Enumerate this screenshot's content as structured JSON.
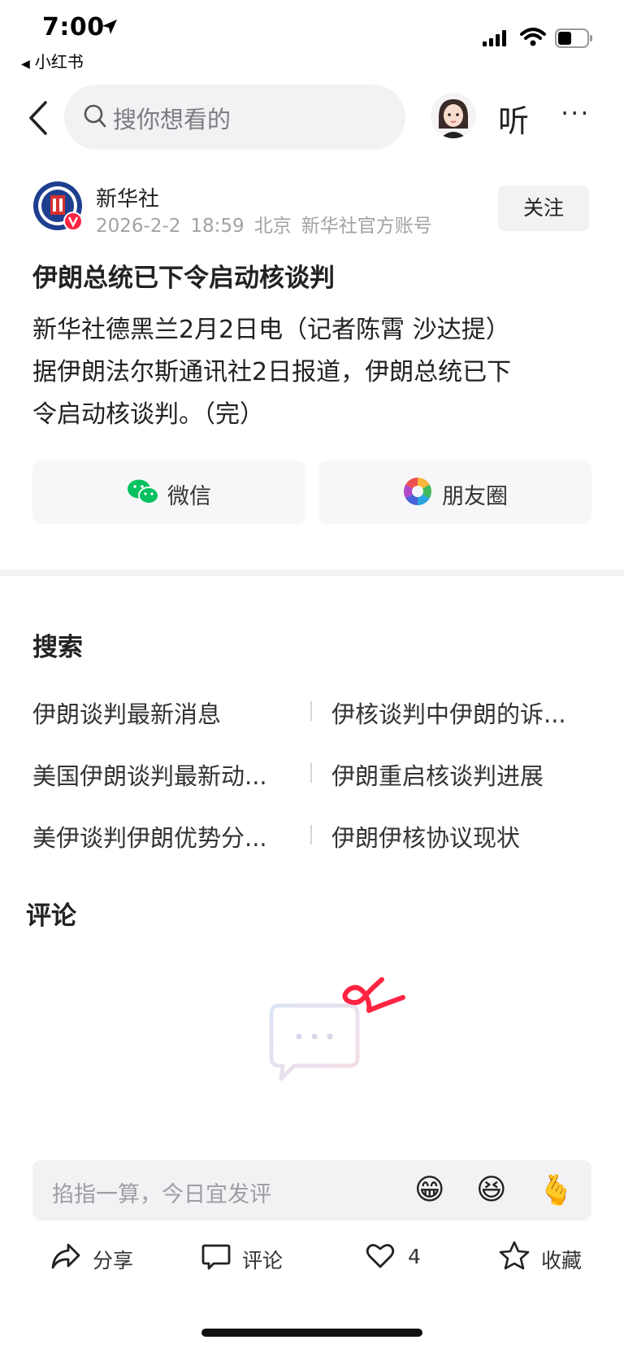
{
  "status_bar": {
    "time": "7:00",
    "back_app": "小红书"
  },
  "nav": {
    "search_placeholder": "搜你想看的",
    "listen_label": "听",
    "more_label": "···"
  },
  "author": {
    "name": "新华社",
    "date": "2026-2-2",
    "time": "18:59",
    "location": "北京",
    "account_type": "新华社官方账号",
    "follow_label": "关注"
  },
  "article": {
    "title": "伊朗总统已下令启动核谈判",
    "body_lines": [
      "新华社德黑兰2月2日电（记者陈霄 沙达提）",
      "据伊朗法尔斯通讯社2日报道，伊朗总统已下",
      "令启动核谈判。（完）"
    ]
  },
  "share": {
    "wechat_label": "微信",
    "moments_label": "朋友圈"
  },
  "search_section": {
    "heading": "搜索",
    "suggestions": [
      [
        "伊朗谈判最新消息",
        "伊核谈判中伊朗的诉..."
      ],
      [
        "美国伊朗谈判最新动...",
        "伊朗重启核谈判进展"
      ],
      [
        "美伊谈判伊朗优势分...",
        "伊朗伊核协议现状"
      ]
    ]
  },
  "comments": {
    "heading": "评论",
    "input_placeholder": "掐指一算，今日宜发评"
  },
  "emojis": [
    "😁",
    "😆",
    "🫰"
  ],
  "bottom_actions": {
    "share_label": "分享",
    "comment_label": "评论",
    "like_count": "4",
    "collect_label": "收藏"
  },
  "colors": {
    "accent_red": "#ff2442",
    "wechat_green": "#07c160",
    "follow_bg": "#f2f2f4"
  }
}
